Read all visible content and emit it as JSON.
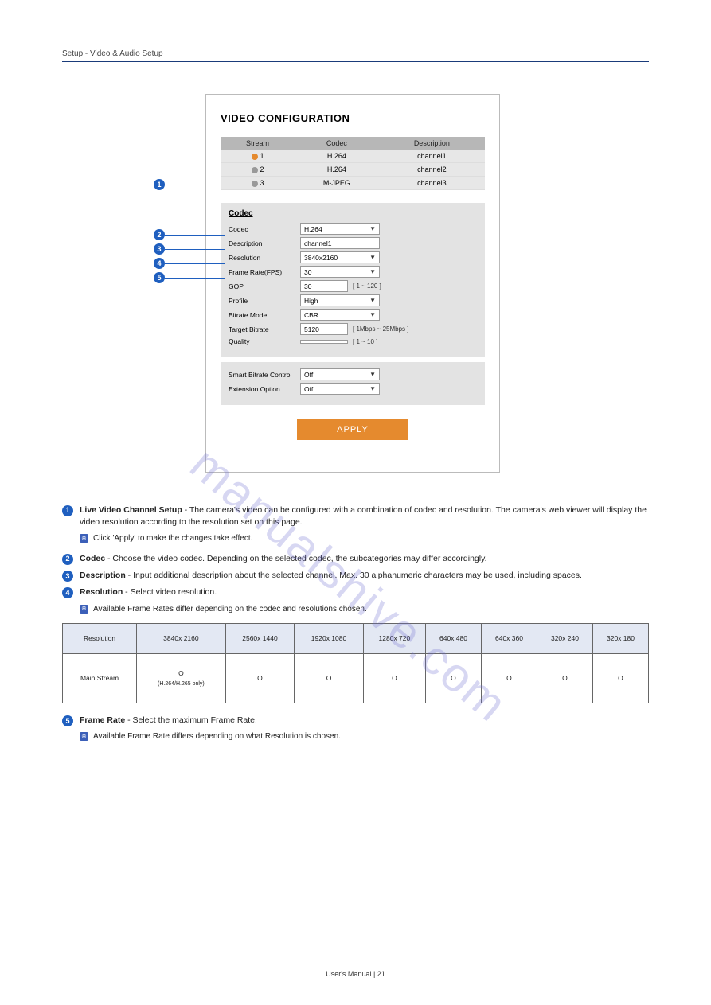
{
  "header": "Setup - Video & Audio Setup",
  "watermark": "manualshive.com",
  "screenshot": {
    "title": "VIDEO CONFIGURATION",
    "table": {
      "headers": [
        "Stream",
        "Codec",
        "Description"
      ],
      "rows": [
        {
          "n": "1",
          "codec": "H.264",
          "desc": "channel1",
          "active": true
        },
        {
          "n": "2",
          "codec": "H.264",
          "desc": "channel2",
          "active": false
        },
        {
          "n": "3",
          "codec": "M-JPEG",
          "desc": "channel3",
          "active": false
        }
      ]
    },
    "codec": {
      "head": "Codec",
      "rows": [
        {
          "label": "Codec",
          "value": "H.264",
          "type": "select"
        },
        {
          "label": "Description",
          "value": "channel1",
          "type": "input"
        },
        {
          "label": "Resolution",
          "value": "3840x2160",
          "type": "select"
        },
        {
          "label": "Frame Rate(FPS)",
          "value": "30",
          "type": "select"
        },
        {
          "label": "GOP",
          "value": "30",
          "type": "num",
          "hint": "[ 1 ~ 120 ]"
        },
        {
          "label": "Profile",
          "value": "High",
          "type": "select"
        },
        {
          "label": "Bitrate Mode",
          "value": "CBR",
          "type": "select"
        },
        {
          "label": "Target Bitrate",
          "value": "5120",
          "type": "num",
          "hint": "[ 1Mbps ~ 25Mbps ]"
        },
        {
          "label": "Quality",
          "value": "",
          "type": "num",
          "hint": "[ 1 ~ 10 ]"
        }
      ]
    },
    "sbc": [
      {
        "label": "Smart Bitrate Control",
        "value": "Off"
      },
      {
        "label": "Extension Option",
        "value": "Off"
      }
    ],
    "apply": "APPLY"
  },
  "callouts": [
    "1",
    "2",
    "3",
    "4",
    "5"
  ],
  "items": [
    {
      "n": "1",
      "title": "Live Video Channel Setup",
      "body": " - The camera's video can be configured with a combination of codec and resolution. The camera's web viewer will display the video resolution according to the resolution set on this page."
    },
    {
      "n": "2",
      "title": "Codec",
      "body": " - Choose the video codec. Depending on the selected codec, the subcategories may differ accordingly."
    },
    {
      "n": "3",
      "title": "Description",
      "body": " - Input additional description about the selected channel. Max. 30 alphanumeric characters may be used, including spaces."
    },
    {
      "n": "4",
      "title": "Resolution",
      "body": " - Select video resolution."
    },
    {
      "n": "5",
      "title": "Frame Rate",
      "body": " - Select the maximum Frame Rate."
    }
  ],
  "notes": [
    {
      "after": 0,
      "text": "Click 'Apply' to make the changes take effect."
    },
    {
      "after": 3,
      "text": "Available Frame Rates differ depending on the codec and resolutions chosen."
    },
    {
      "after": 4,
      "text": "Available Frame Rate differs depending on what Resolution is chosen."
    }
  ],
  "resTable": {
    "headers": [
      "3840x 2160",
      "2560x 1440",
      "1920x 1080",
      "1280x 720",
      "640x 480",
      "640x 360",
      "320x 240",
      "320x 180"
    ],
    "firstCol": "Resolution",
    "rowLabel": "Main Stream",
    "cells": [
      "O",
      "O",
      "O",
      "O",
      "O",
      "O",
      "O",
      "O"
    ],
    "cell0note": "(H.264/H.265 only)"
  },
  "footer": "User's Manual  |  21"
}
